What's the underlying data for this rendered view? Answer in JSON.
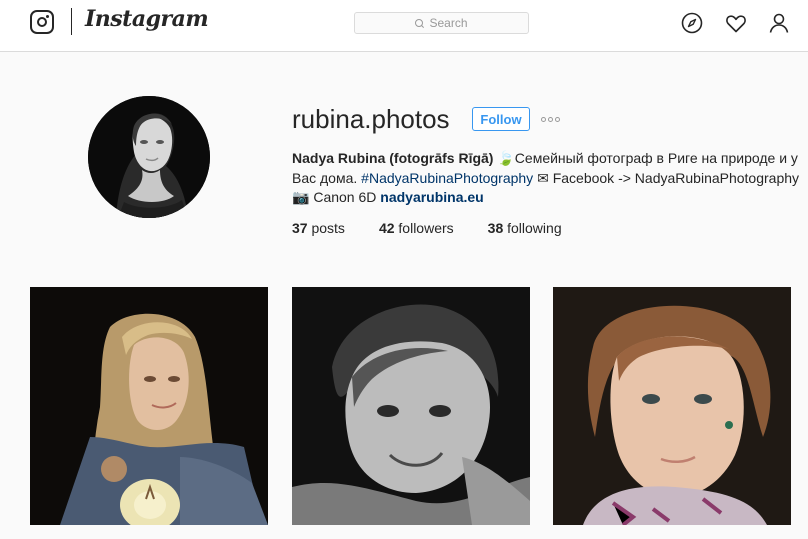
{
  "header": {
    "wordmark": "Instagram",
    "search_placeholder": "Search",
    "icons": [
      "camera-logo-icon",
      "compass-icon",
      "heart-icon",
      "person-icon"
    ]
  },
  "profile": {
    "username": "rubina.photos",
    "follow_label": "Follow",
    "more_label": "•••",
    "bio": {
      "name": "Nadya Rubina (fotogrāfs Rīgā)",
      "emoji1": "🍃",
      "text1": "Семейный фотограф в Риге на природе и у Вас дома.",
      "hashtag": "#NadyaRubinaPhotography",
      "mail_emoji": "✉",
      "facebook_text": "Facebook -> NadyaRubinaPhotography",
      "camera_emoji": "📷",
      "camera_text": "Canon 6D",
      "website": "nadyarubina.eu"
    },
    "stats": {
      "posts_count": "37",
      "posts_label": "posts",
      "followers_count": "42",
      "followers_label": "followers",
      "following_count": "38",
      "following_label": "following"
    }
  },
  "colors": {
    "accent": "#3897f0",
    "link": "#003569",
    "border": "#dbdbdb",
    "background": "#fafafa"
  }
}
